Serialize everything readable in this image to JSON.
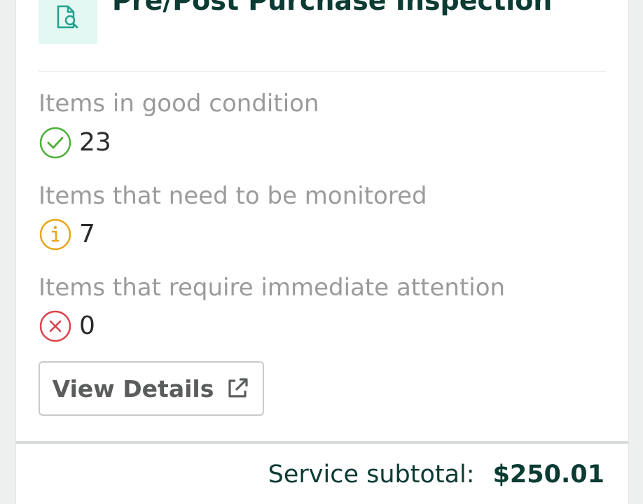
{
  "service": {
    "title": "Pre/Post Purchase Inspection",
    "icon": "document-search-icon"
  },
  "metrics": [
    {
      "label": "Items in good condition",
      "value": "23",
      "icon": "check-circle-icon",
      "color": "#4caf37"
    },
    {
      "label": "Items that need to be monitored",
      "value": "7",
      "icon": "info-circle-icon",
      "color": "#e8a617"
    },
    {
      "label": "Items that require immediate attention",
      "value": "0",
      "icon": "x-circle-icon",
      "color": "#d9434a"
    }
  ],
  "actions": {
    "view_details_label": "View Details",
    "view_details_icon": "external-link-icon"
  },
  "footer": {
    "subtotal_label": "Service subtotal:",
    "subtotal_value": "$250.01"
  },
  "colors": {
    "heading": "#0b3b33",
    "icon_teal": "#21a38c",
    "icon_bg": "#e3f7f3"
  }
}
